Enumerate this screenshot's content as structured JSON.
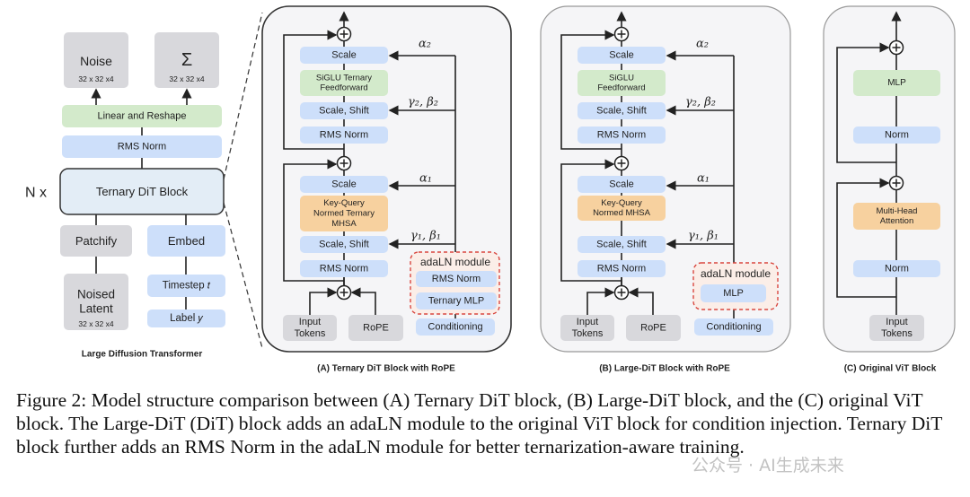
{
  "colors": {
    "norm": "#cddffa",
    "ffn": "#d3eacb",
    "attn": "#f7d19f",
    "io": "#d8d8dc",
    "panel": "#f5f5f7",
    "adaln_border": "#d9473f",
    "adaln_fill": "#fbeee8",
    "highlight": "#e0303a"
  },
  "left": {
    "noise": "Noise",
    "noise_dim": "32 x 32 x4",
    "sigma": "Σ",
    "sigma_dim": "32 x 32 x4",
    "linear": "Linear and Reshape",
    "rms": "RMS Norm",
    "nx": "N x",
    "block": "Ternary DiT Block",
    "patchify": "Patchify",
    "embed": "Embed",
    "latent": [
      "Noised",
      "Latent"
    ],
    "latent_dim": "32 x 32 x4",
    "timestep": "Timestep 𝑡",
    "label": "Label 𝑦",
    "caption": "Large Diffusion Transformer"
  },
  "panel_a": {
    "scale2": "Scale",
    "ffn": [
      "SiGLU Ternary",
      "Feedforward"
    ],
    "shift2": "Scale, Shift",
    "norm2": "RMS Norm",
    "scale1": "Scale",
    "attn": [
      "Key-Query",
      "Normed Ternary",
      "MHSA"
    ],
    "shift1": "Scale, Shift",
    "norm1": "RMS Norm",
    "tokens": [
      "Input",
      "Tokens"
    ],
    "rope": "RoPE",
    "adaln": "adaLN module",
    "adaln_norm": "RMS Norm",
    "adaln_mlp": "Ternary MLP",
    "cond": "Conditioning",
    "alpha2": "α₂",
    "gb2": "γ₂, β₂",
    "alpha1": "α₁",
    "gb1": "γ₁, β₁",
    "caption": "(A) Ternary DiT Block with RoPE"
  },
  "panel_b": {
    "scale2": "Scale",
    "ffn": [
      "SiGLU",
      "Feedforward"
    ],
    "shift2": "Scale, Shift",
    "norm2": "RMS Norm",
    "scale1": "Scale",
    "attn": [
      "Key-Query",
      "Normed MHSA"
    ],
    "shift1": "Scale, Shift",
    "norm1": "RMS Norm",
    "tokens": [
      "Input",
      "Tokens"
    ],
    "rope": "RoPE",
    "adaln": "adaLN module",
    "adaln_mlp": "MLP",
    "cond": "Conditioning",
    "alpha2": "α₂",
    "gb2": "γ₂, β₂",
    "alpha1": "α₁",
    "gb1": "γ₁, β₁",
    "caption": "(B) Large-DiT Block with RoPE"
  },
  "panel_c": {
    "mlp": "MLP",
    "norm2": "Norm",
    "attn": [
      "Multi-Head",
      "Attention"
    ],
    "norm1": "Norm",
    "tokens": [
      "Input",
      "Tokens"
    ],
    "caption": "(C) Original ViT Block"
  },
  "caption": "Figure 2: Model structure comparison between (A) Ternary DiT block, (B) Large-DiT block, and the (C) original ViT block. The Large-DiT (DiT) block adds an adaLN module to the original ViT block for condition injection. Ternary DiT block further adds an RMS Norm in the adaLN module for better ternarization-aware training.",
  "watermark": "公众号 · AI生成未来"
}
